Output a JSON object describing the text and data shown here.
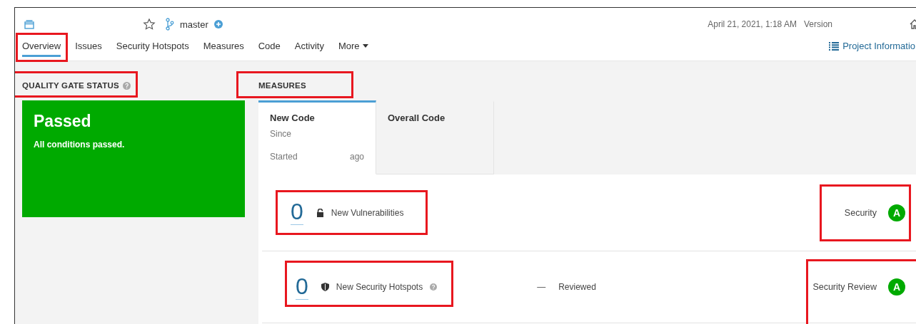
{
  "header": {
    "branch": "master",
    "date": "April 21, 2021, 1:18 AM",
    "version_label": "Version"
  },
  "nav": {
    "tabs": [
      {
        "label": "Overview",
        "selected": true,
        "highlighted": true
      },
      {
        "label": "Issues",
        "selected": false,
        "highlighted": false
      },
      {
        "label": "Security Hotspots",
        "selected": false,
        "highlighted": false
      },
      {
        "label": "Measures",
        "selected": false,
        "highlighted": false
      },
      {
        "label": "Code",
        "selected": false,
        "highlighted": false
      },
      {
        "label": "Activity",
        "selected": false,
        "highlighted": false
      },
      {
        "label": "More",
        "selected": false,
        "highlighted": false
      }
    ],
    "project_info": "Project Informatio"
  },
  "quality_gate": {
    "heading": "QUALITY GATE STATUS",
    "highlighted": true,
    "status": "Passed",
    "message": "All conditions passed.",
    "color": "#00aa00"
  },
  "measures": {
    "heading": "MEASURES",
    "highlighted": true,
    "period_tabs": [
      {
        "title": "New Code",
        "lines": [
          "Since"
        ],
        "started": "Started",
        "ago": "ago",
        "selected": true
      },
      {
        "title": "Overall Code",
        "selected": false
      }
    ],
    "rows": [
      {
        "value": "0",
        "label": "New Vulnerabilities",
        "kind": "vulnerabilities",
        "help": false,
        "highlighted": true,
        "rating_label": "Security",
        "rating": "A",
        "rating_highlighted": true
      },
      {
        "value": "0",
        "label": "New Security Hotspots",
        "kind": "hotspots",
        "help": true,
        "highlighted": true,
        "reviewed_value": "—",
        "reviewed_label": "Reviewed",
        "rating_label": "Security Review",
        "rating": "A",
        "rating_highlighted": true
      }
    ]
  }
}
